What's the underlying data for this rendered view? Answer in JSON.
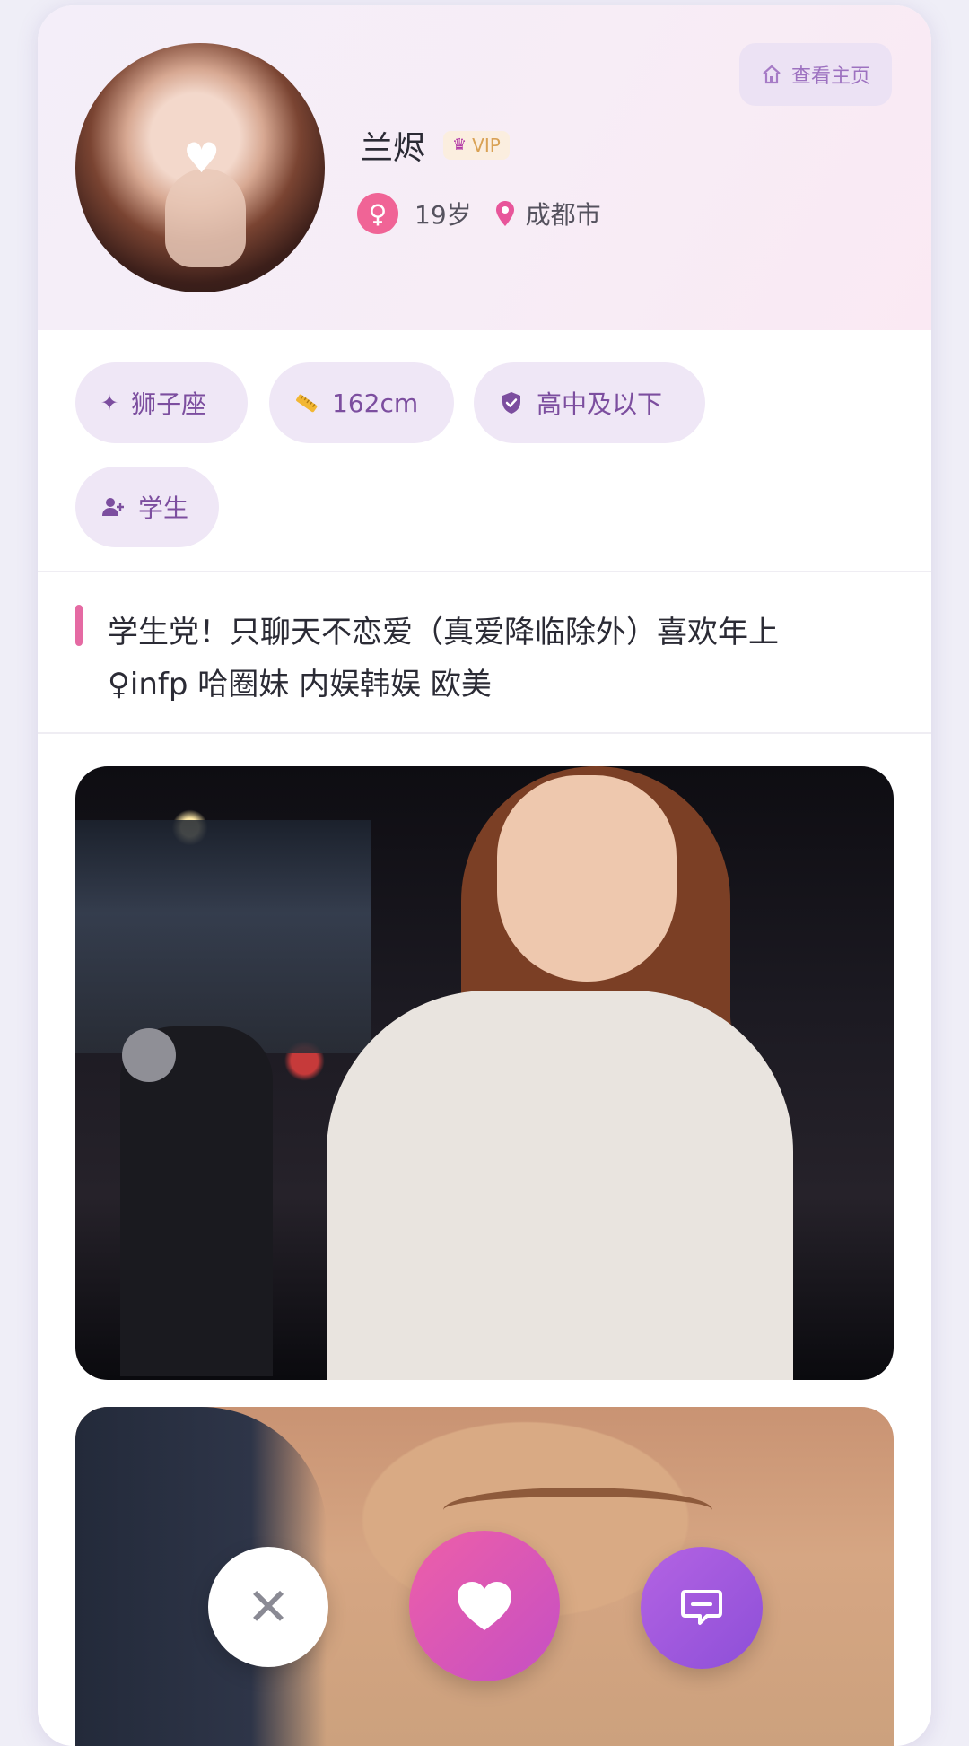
{
  "profile": {
    "name": "兰烬",
    "vip_label": "VIP",
    "gender_symbol": "♀",
    "age": "19岁",
    "city": "成都市"
  },
  "header_actions": {
    "home_label": "查看主页"
  },
  "tags": {
    "zodiac": "狮子座",
    "height": "162cm",
    "education": "高中及以下",
    "occupation": "学生"
  },
  "bio": {
    "text": "学生党！只聊天不恋爱（真爱降临除外）喜欢年上\n♀infp 哈圈妹 内娱韩娱 欧美"
  },
  "actions": {
    "close_symbol": "✕"
  },
  "colors": {
    "accent_purple": "#7c4e9f",
    "accent_pink": "#f06496",
    "like_gradient_start": "#ee5fa8",
    "like_gradient_end": "#c54fc4",
    "chat_gradient_start": "#b463e3",
    "chat_gradient_end": "#8d4fd8"
  }
}
